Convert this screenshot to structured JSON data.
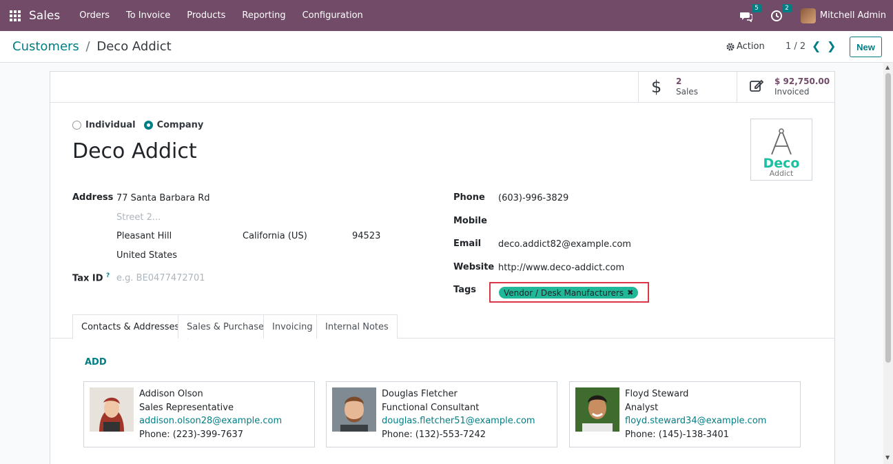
{
  "navbar": {
    "app_name": "Sales",
    "menu": [
      "Orders",
      "To Invoice",
      "Products",
      "Reporting",
      "Configuration"
    ],
    "messages_badge": "5",
    "activities_badge": "2",
    "user_name": "Mitchell Admin"
  },
  "control": {
    "breadcrumb_parent": "Customers",
    "breadcrumb_sep": "/",
    "breadcrumb_current": "Deco Addict",
    "action_label": "Action",
    "pager": "1 / 2",
    "new_label": "New"
  },
  "stats": {
    "sales_value": "2",
    "sales_label": "Sales",
    "invoiced_value": "$ 92,750.00",
    "invoiced_label": "Invoiced"
  },
  "company_type": {
    "individual_label": "Individual",
    "company_label": "Company",
    "selected": "Company"
  },
  "company_name": "Deco Addict",
  "logo": {
    "word": "Deco",
    "sub": "Addict"
  },
  "address": {
    "label": "Address",
    "street": "77 Santa Barbara Rd",
    "street2_placeholder": "Street 2...",
    "city": "Pleasant Hill",
    "state": "California (US)",
    "zip": "94523",
    "country": "United States"
  },
  "tax_id": {
    "label": "Tax ID",
    "help": "?",
    "placeholder": "e.g. BE0477472701"
  },
  "contact": {
    "phone_label": "Phone",
    "phone": "(603)-996-3829",
    "mobile_label": "Mobile",
    "mobile": "",
    "email_label": "Email",
    "email": "deco.addict82@example.com",
    "website_label": "Website",
    "website": "http://www.deco-addict.com",
    "tags_label": "Tags",
    "tags": [
      "Vendor / Desk Manufacturers"
    ]
  },
  "tabs": [
    "Contacts & Addresses",
    "Sales & Purchase",
    "Invoicing",
    "Internal Notes"
  ],
  "active_tab": "Contacts & Addresses",
  "add_label": "ADD",
  "contacts": [
    {
      "name": "Addison Olson",
      "role": "Sales Representative",
      "email": "addison.olson28@example.com",
      "phone": "Phone: (223)-399-7637"
    },
    {
      "name": "Douglas Fletcher",
      "role": "Functional Consultant",
      "email": "douglas.fletcher51@example.com",
      "phone": "Phone: (132)-553-7242"
    },
    {
      "name": "Floyd Steward",
      "role": "Analyst",
      "email": "floyd.steward34@example.com",
      "phone": "Phone: (145)-138-3401"
    }
  ],
  "colors": {
    "brand": "#714b67",
    "accent": "#017e84",
    "tag": "#21b799",
    "highlight": "#dc3545"
  }
}
